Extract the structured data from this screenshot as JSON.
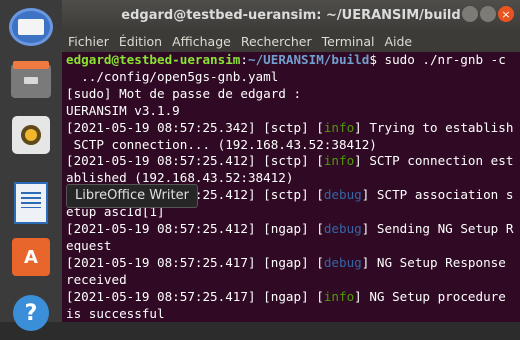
{
  "window": {
    "title": "edgard@testbed-ueransim: ~/UERANSIM/build"
  },
  "menu": [
    "Fichier",
    "Édition",
    "Affichage",
    "Rechercher",
    "Terminal",
    "Aide"
  ],
  "dock": {
    "tooltip": "LibreOffice Writer",
    "store_glyph": "A",
    "help_glyph": "?"
  },
  "terminal": {
    "prompt_user": "edgard@testbed-ueransim",
    "prompt_sep": ":",
    "prompt_path": "~/UERANSIM/build",
    "prompt_symbol": "$ ",
    "command": "sudo ./nr-gnb -c",
    "command_cont": "  ../config/open5gs-gnb.yaml",
    "sudo_line": "[sudo] Mot de passe de edgard :",
    "version_line": "UERANSIM v3.1.9",
    "lines": [
      {
        "ts": "[2021-05-19 08:57:25.342]",
        "comp": "[sctp]",
        "level": "info",
        "msg": "Trying to establish",
        "cont": " SCTP connection... (192.168.43.52:38412)"
      },
      {
        "ts": "[2021-05-19 08:57:25.412]",
        "comp": "[sctp]",
        "level": "info",
        "msg": "SCTP connection est",
        "cont": "ablished (192.168.43.52:38412)"
      },
      {
        "ts": "[2021-05-19 08:57:25.412]",
        "comp": "[sctp]",
        "level": "debug",
        "msg": "SCTP association s",
        "cont": "etup ascId[1]"
      },
      {
        "ts": "[2021-05-19 08:57:25.412]",
        "comp": "[ngap]",
        "level": "debug",
        "msg": "Sending NG Setup R",
        "cont": "equest"
      },
      {
        "ts": "[2021-05-19 08:57:25.417]",
        "comp": "[ngap]",
        "level": "debug",
        "msg": "NG Setup Response",
        "cont": "received"
      },
      {
        "ts": "[2021-05-19 08:57:25.417]",
        "comp": "[ngap]",
        "level": "info",
        "msg": "NG Setup procedure",
        "cont": "is successful"
      }
    ]
  },
  "colors": {
    "terminal_bg": "#300a24",
    "info": "#4e9a06",
    "debug": "#3465a4",
    "prompt_user": "#8ae234",
    "prompt_path": "#729fcf"
  }
}
